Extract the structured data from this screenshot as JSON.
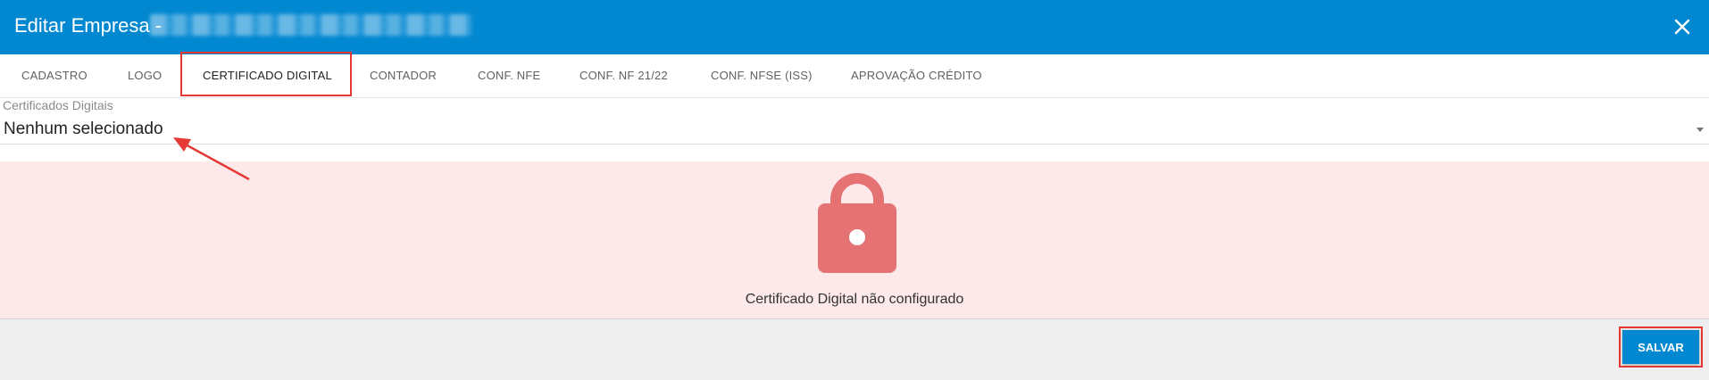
{
  "dialog": {
    "title": "Editar Empresa -"
  },
  "tabs": [
    {
      "label": "CADASTRO"
    },
    {
      "label": "LOGO"
    },
    {
      "label": "CERTIFICADO DIGITAL",
      "active": true
    },
    {
      "label": "CONTADOR"
    },
    {
      "label": "CONF. NFE"
    },
    {
      "label": "CONF. NF 21/22"
    },
    {
      "label": "CONF. NFSE (ISS)"
    },
    {
      "label": "APROVAÇÃO CRÉDITO"
    }
  ],
  "certificates_field": {
    "label": "Certificados Digitais",
    "value": "Nenhum selecionado"
  },
  "status_panel": {
    "icon": "unlocked-padlock-icon",
    "message": "Certificado Digital não configurado"
  },
  "footer": {
    "save_label": "SALVAR"
  },
  "colors": {
    "header": "#0288d1",
    "warning_background": "#fde8ea",
    "lock_icon": "#e57373",
    "annotation": "#e53935",
    "save_button": "#0288d1"
  }
}
